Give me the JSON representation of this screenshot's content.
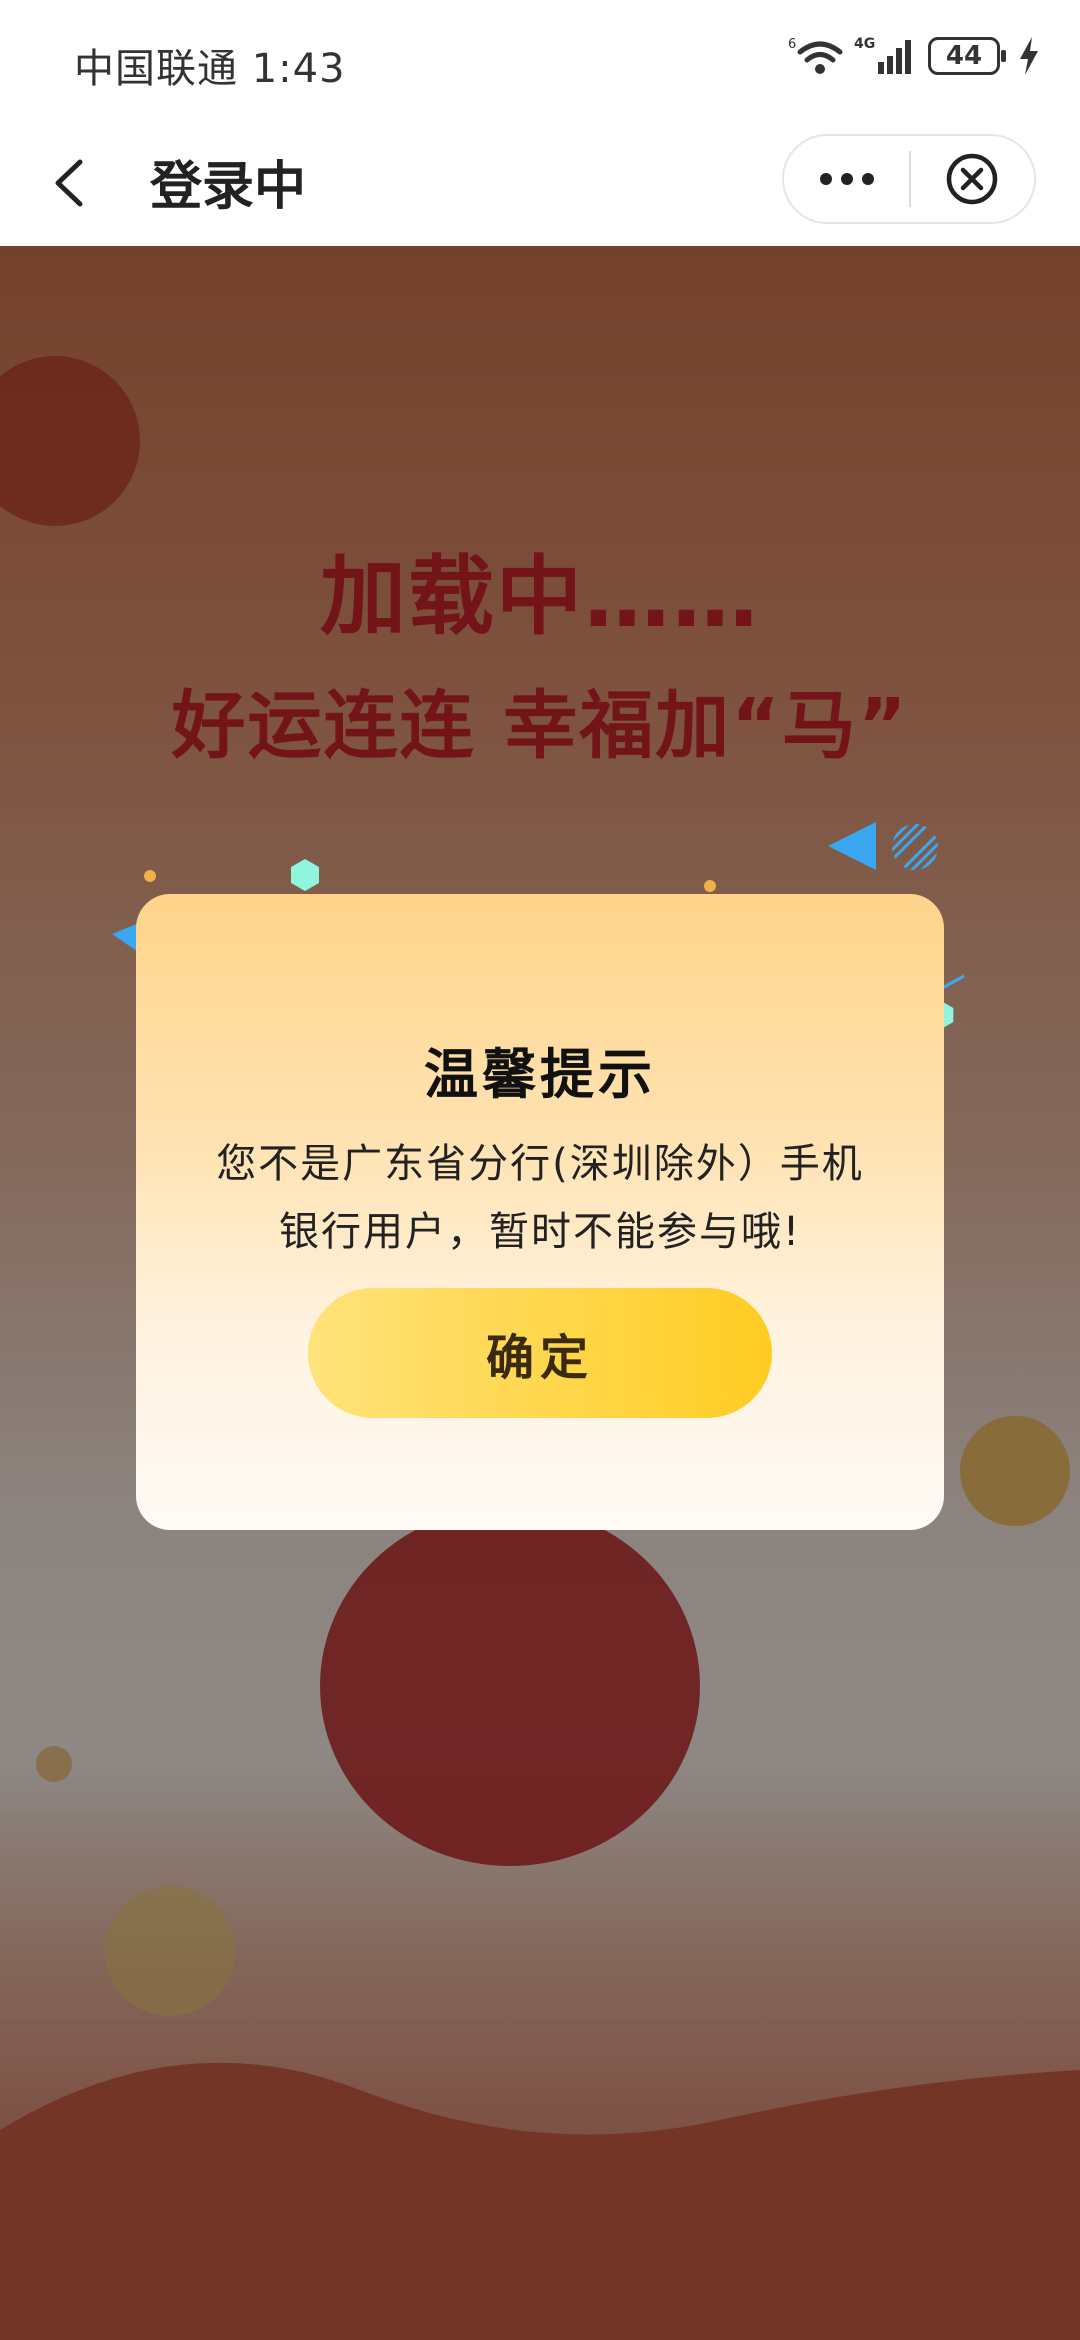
{
  "status_bar": {
    "carrier_time": "中国联通 1:43",
    "battery": "44"
  },
  "nav": {
    "title": "登录中"
  },
  "background": {
    "hero_line1": "加载中……",
    "hero_line2": "好运连连  幸福加“马”"
  },
  "dialog": {
    "title": "温馨提示",
    "message_line1": "您不是广东省分行(深圳除外）手机",
    "message_line2": "银行用户，暂时不能参与哦!",
    "confirm_label": "确定"
  },
  "colors": {
    "accent_yellow": "#ffd33d",
    "hero_red": "#c4242a",
    "decor_blue": "#3aa8f0",
    "decor_mint": "#7ff0d8"
  }
}
